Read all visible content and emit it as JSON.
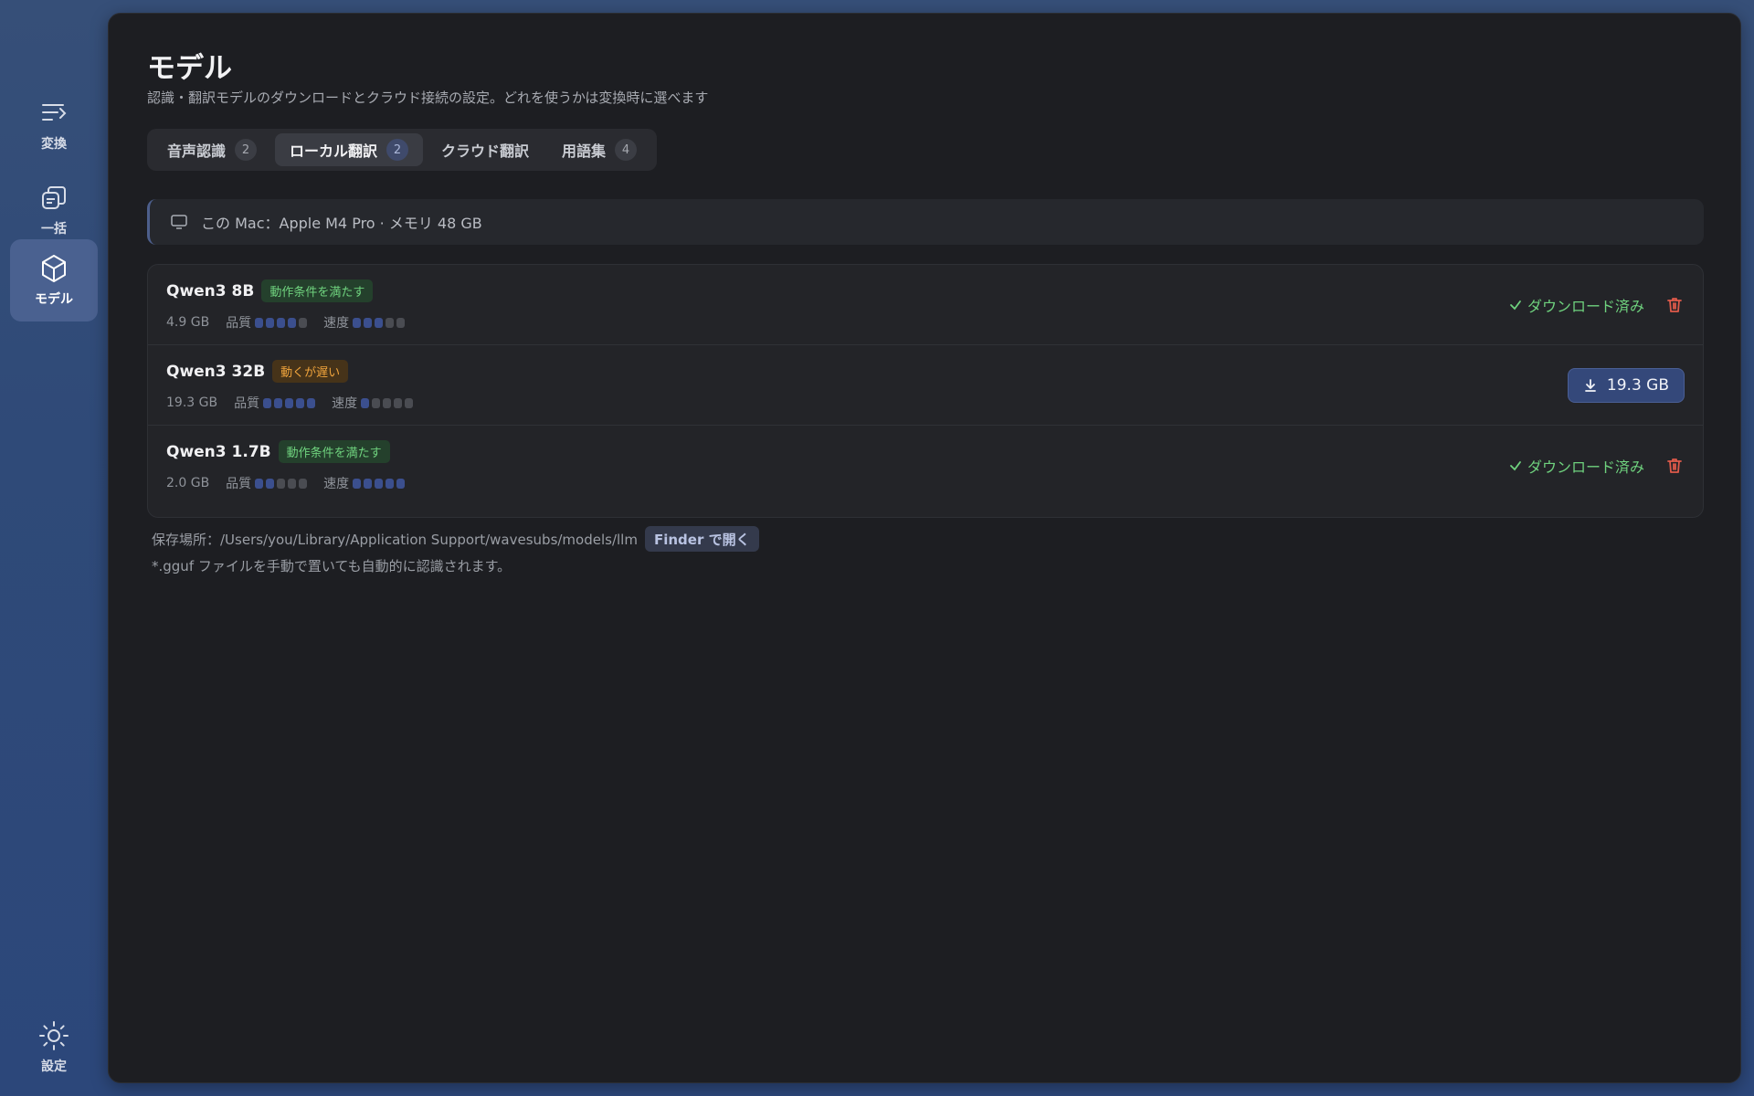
{
  "sidebar": {
    "items": [
      {
        "label": "変換",
        "icon": "convert-icon",
        "active": false
      },
      {
        "label": "一括",
        "icon": "batch-icon",
        "active": false
      },
      {
        "label": "モデル",
        "icon": "model-cube-icon",
        "active": true
      },
      {
        "label": "設定",
        "icon": "settings-sun-icon",
        "active": false
      }
    ]
  },
  "page": {
    "title": "モデル",
    "subtitle": "認識・翻訳モデルのダウンロードとクラウド接続の設定。どれを使うかは変換時に選べます"
  },
  "tabs": [
    {
      "label": "音声認識",
      "count": "2",
      "active": false
    },
    {
      "label": "ローカル翻訳",
      "count": "2",
      "active": true
    },
    {
      "label": "クラウド翻訳",
      "count": "",
      "active": false
    },
    {
      "label": "用語集",
      "count": "4",
      "active": false
    }
  ],
  "machine": {
    "text": "この Mac：Apple M4 Pro · メモリ 48 GB",
    "icon": "monitor-icon"
  },
  "models": [
    {
      "name": "Qwen3 8B",
      "badge": "動作条件を満たす",
      "badge_kind": "ok",
      "size": "4.9 GB",
      "quality_label": "品質",
      "quality": 4,
      "speed_label": "速度",
      "speed": 3,
      "status": "downloaded",
      "downloaded_label": "ダウンロード済み"
    },
    {
      "name": "Qwen3 32B",
      "badge": "動くが遅い",
      "badge_kind": "slow",
      "size": "19.3 GB",
      "quality_label": "品質",
      "quality": 5,
      "speed_label": "速度",
      "speed": 1,
      "status": "available",
      "download_label": "19.3 GB"
    },
    {
      "name": "Qwen3 1.7B",
      "badge": "動作条件を満たす",
      "badge_kind": "ok",
      "size": "2.0 GB",
      "quality_label": "品質",
      "quality": 2,
      "speed_label": "速度",
      "speed": 5,
      "status": "downloaded",
      "downloaded_label": "ダウンロード済み"
    }
  ],
  "storage": {
    "label": "保存場所：/Users/you/Library/Application Support/wavesubs/models/llm",
    "finder_button": "Finder で開く",
    "note": "*.gguf ファイルを手動で置いても自動的に認識されます。"
  },
  "colors": {
    "accent": "#34487a",
    "ok": "#6fd27e",
    "warn": "#f0a43c",
    "danger": "#e05a4a"
  }
}
